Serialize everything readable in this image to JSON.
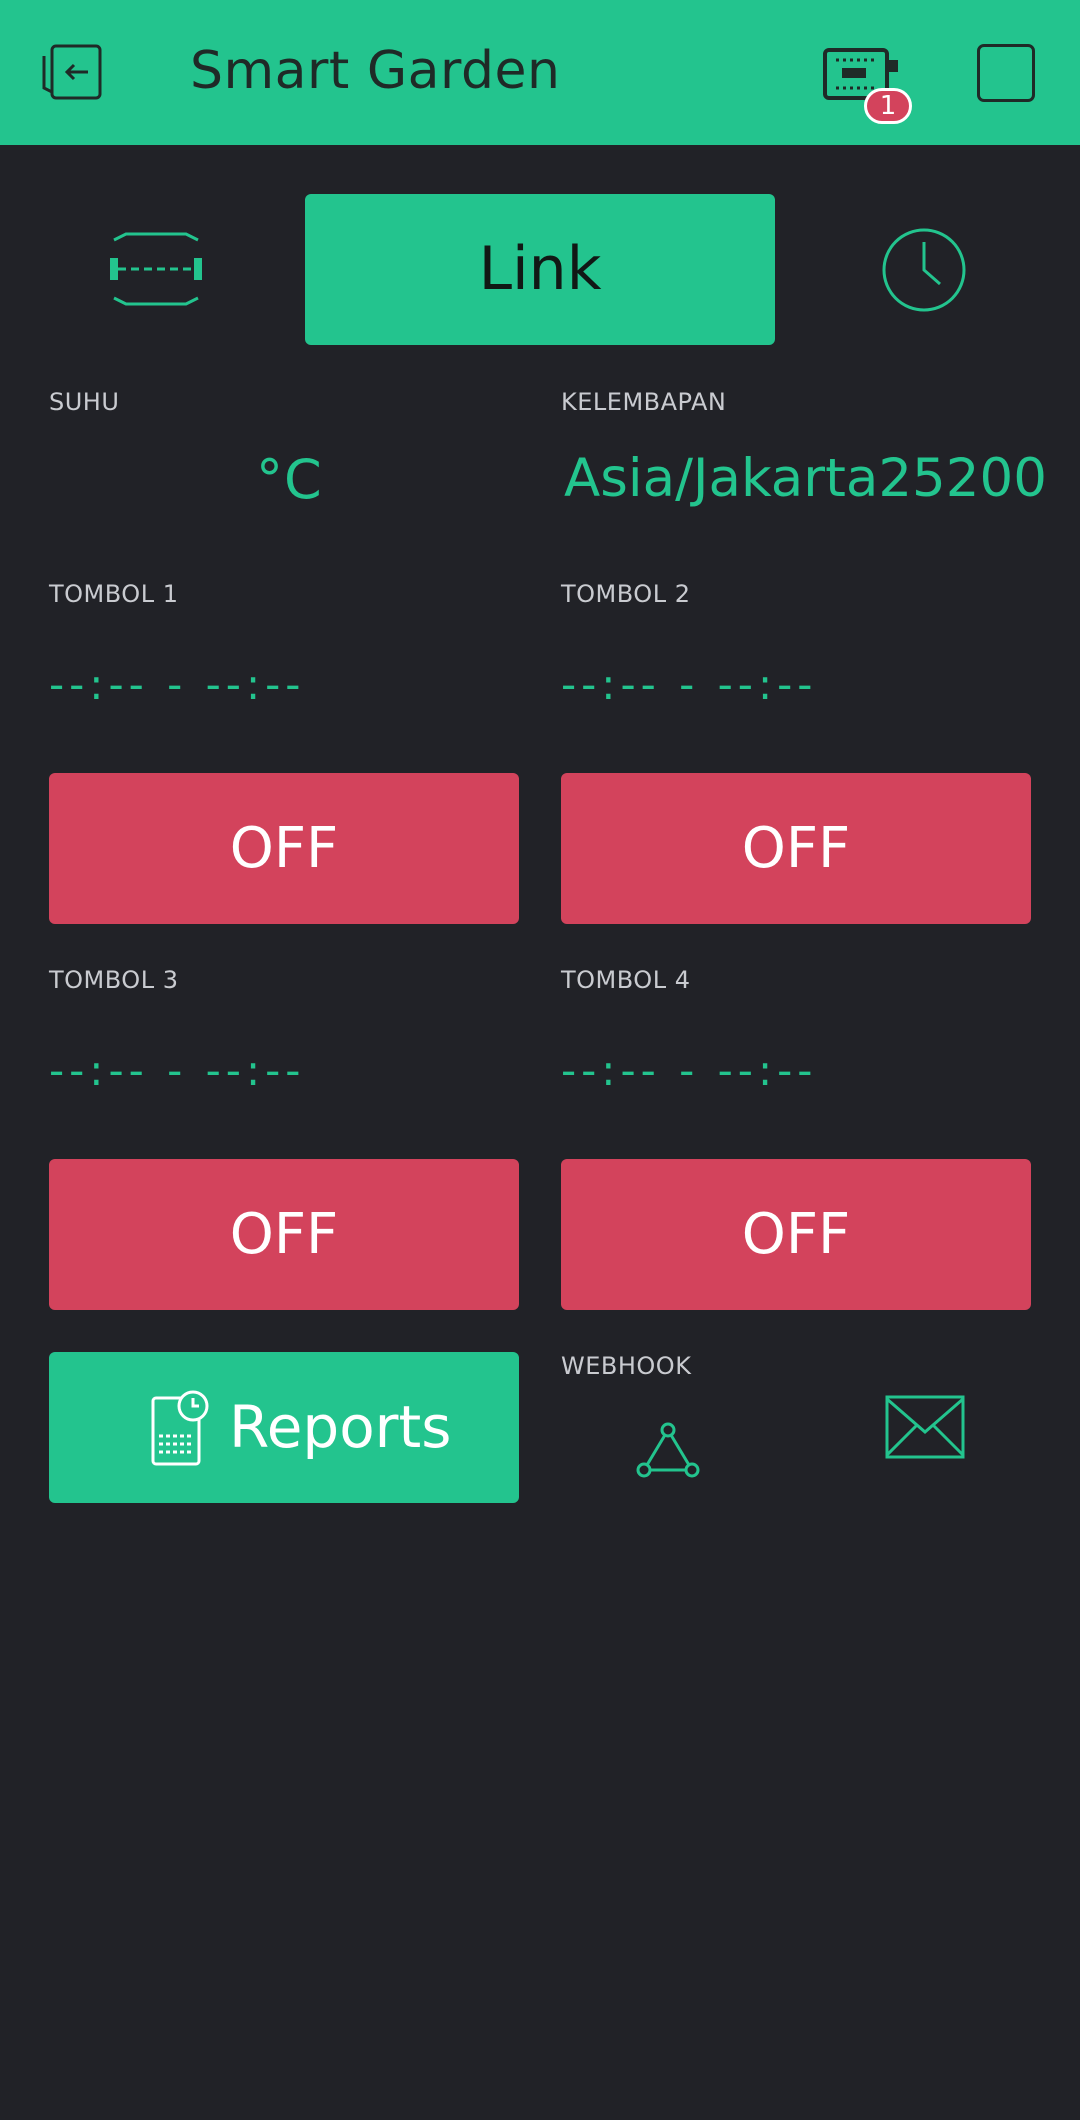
{
  "header": {
    "title": "Smart Garden",
    "back_icon": "back-icon",
    "device_icon": "device-icon",
    "notification_count": "1",
    "stop_icon": "stop-icon"
  },
  "toolbar": {
    "bridge_icon": "bridge-icon",
    "link_label": "Link",
    "clock_icon": "clock-icon"
  },
  "sensors": {
    "suhu_label": "SUHU",
    "suhu_value": "°C",
    "kelembapan_label": "KELEMBAPAN",
    "kelembapan_value": "Asia/Jakarta25200"
  },
  "buttons": [
    {
      "label": "TOMBOL 1",
      "time": "--:-- - --:--",
      "state": "OFF"
    },
    {
      "label": "TOMBOL 2",
      "time": "--:-- - --:--",
      "state": "OFF"
    },
    {
      "label": "TOMBOL 3",
      "time": "--:-- - --:--",
      "state": "OFF"
    },
    {
      "label": "TOMBOL 4",
      "time": "--:-- - --:--",
      "state": "OFF"
    }
  ],
  "footer": {
    "reports_label": "Reports",
    "reports_icon": "reports-icon",
    "webhook_label": "WEBHOOK",
    "webhook_icon": "webhook-icon",
    "mail_icon": "mail-icon"
  },
  "colors": {
    "accent": "#23c48e",
    "background": "#212227",
    "off_button": "#d3435c",
    "label": "#c9cbd0"
  }
}
